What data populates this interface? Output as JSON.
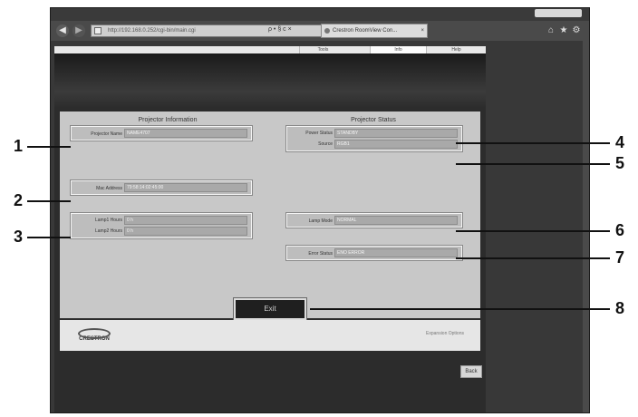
{
  "browser": {
    "url": "http://192.168.0.252/cgi-bin/main.cgi",
    "tab_title": "Crestron RoomView Con...",
    "nav": {
      "back_icon": "back-arrow-icon",
      "forward_icon": "forward-arrow-icon"
    },
    "addr_glyphs": "ρ • § c ×",
    "tab_close": "×",
    "toolbar_icons": [
      "⌂",
      "★",
      "⚙"
    ]
  },
  "menu": {
    "tools": "Tools",
    "info": "Info",
    "help": "Help"
  },
  "projector_info": {
    "title": "Projector Information",
    "projector_name_label": "Projector Name",
    "projector_name_value": "NAME4707",
    "mac_address_label": "Mac Address",
    "mac_address_value": "79:58:14:02:45:00",
    "lamp1_label": "Lamp1 Hours",
    "lamp1_value": "0 h",
    "lamp2_label": "Lamp2 Hours",
    "lamp2_value": "0 h"
  },
  "projector_status": {
    "title": "Projector Status",
    "power_status_label": "Power Status",
    "power_status_value": "STANDBY",
    "source_label": "Source",
    "source_value": "RGB1",
    "lamp_mode_label": "Lamp Mode",
    "lamp_mode_value": "NORMAL",
    "error_status_label": "Error Status",
    "error_status_value": "ENO ERROR"
  },
  "exit_label": "Exit",
  "footer": {
    "logo_text": "CRESTRON",
    "right_text": "Expansion Options"
  },
  "back_label": "Back",
  "callouts": [
    "1",
    "2",
    "3",
    "4",
    "5",
    "6",
    "7",
    "8"
  ]
}
